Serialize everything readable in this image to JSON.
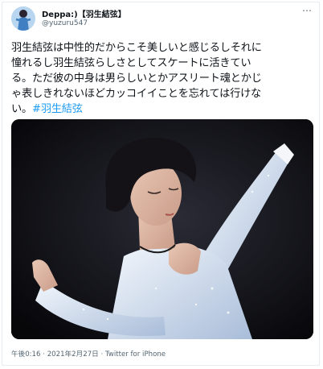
{
  "user": {
    "display_name": "Deppa:)【羽生結弦】",
    "handle": "@yuzuru547"
  },
  "menu": {
    "more_glyph": "⋯"
  },
  "tweet": {
    "lines": [
      "羽生結弦は中性的だからこそ美しいと感じるしそれに",
      "憧れるし羽生結弦らしさとしてスケートに活きてい",
      "る。ただ彼の中身は男らしいとかアスリート魂とかじ",
      "ゃ表しきれないほどカッコイイことを忘れては行けな"
    ],
    "last_line_text": "い。",
    "hashtag": "#羽生結弦"
  },
  "meta": {
    "time": "午後0:16",
    "separator": "·",
    "date": "2021年2月27日",
    "source": "Twitter for iPhone"
  },
  "colors": {
    "link": "#1d9bf0",
    "secondary_text": "#536471",
    "costume": "#dce6f3"
  }
}
